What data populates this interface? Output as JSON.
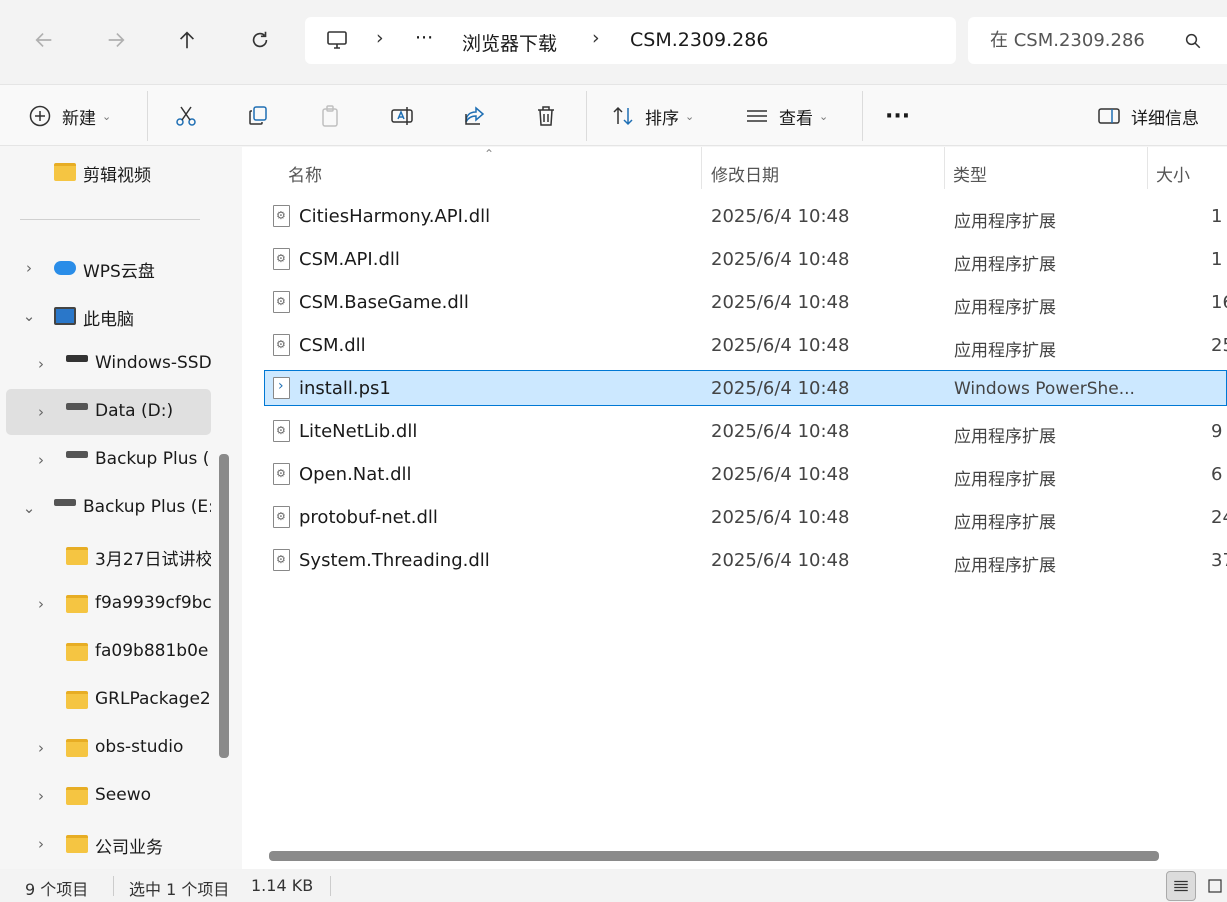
{
  "nav": {
    "breadcrumb": [
      "浏览器下载",
      "CSM.2309.286"
    ],
    "more": "···",
    "search_placeholder": "在 CSM.2309.286"
  },
  "toolbar": {
    "new_label": "新建",
    "sort_label": "排序",
    "view_label": "查看",
    "more": "···",
    "details_label": "详细信息"
  },
  "sidebar": {
    "items": [
      {
        "label": "剪辑视频",
        "icon": "folder-icon",
        "expandable": false
      },
      {
        "label": "WPS云盘",
        "icon": "cloud-icon",
        "expandable": true,
        "expanded": false
      },
      {
        "label": "此电脑",
        "icon": "computer-icon",
        "expandable": true,
        "expanded": true
      },
      {
        "label": "Windows-SSD",
        "icon": "windows-drive-icon",
        "expandable": true,
        "expanded": false
      },
      {
        "label": "Data (D:)",
        "icon": "drive-icon",
        "expandable": true,
        "expanded": false,
        "selected": true
      },
      {
        "label": "Backup Plus (",
        "icon": "drive-icon",
        "expandable": true,
        "expanded": false
      },
      {
        "label": "Backup Plus (E:",
        "icon": "drive-icon",
        "expandable": true,
        "expanded": true
      },
      {
        "label": "3月27日试讲校",
        "icon": "folder-icon",
        "expandable": false
      },
      {
        "label": "f9a9939cf9bc",
        "icon": "folder-icon",
        "expandable": true,
        "expanded": false
      },
      {
        "label": "fa09b881b0e",
        "icon": "folder-icon",
        "expandable": false
      },
      {
        "label": "GRLPackage2",
        "icon": "folder-icon",
        "expandable": false
      },
      {
        "label": "obs-studio",
        "icon": "folder-icon",
        "expandable": true,
        "expanded": false
      },
      {
        "label": "Seewo",
        "icon": "folder-icon",
        "expandable": true,
        "expanded": false
      },
      {
        "label": "公司业务",
        "icon": "folder-icon",
        "expandable": true,
        "expanded": false
      }
    ]
  },
  "columns": {
    "name": "名称",
    "date": "修改日期",
    "type": "类型",
    "size": "大小"
  },
  "files": [
    {
      "name": "CitiesHarmony.API.dll",
      "date": "2025/6/4 10:48",
      "type": "应用程序扩展",
      "size": "1",
      "icon": "dll-file-icon"
    },
    {
      "name": "CSM.API.dll",
      "date": "2025/6/4 10:48",
      "type": "应用程序扩展",
      "size": "1",
      "icon": "dll-file-icon"
    },
    {
      "name": "CSM.BaseGame.dll",
      "date": "2025/6/4 10:48",
      "type": "应用程序扩展",
      "size": "16",
      "icon": "dll-file-icon"
    },
    {
      "name": "CSM.dll",
      "date": "2025/6/4 10:48",
      "type": "应用程序扩展",
      "size": "25",
      "icon": "dll-file-icon"
    },
    {
      "name": "install.ps1",
      "date": "2025/6/4 10:48",
      "type": "Windows PowerShe...",
      "size": "",
      "icon": "powershell-file-icon",
      "selected": true
    },
    {
      "name": "LiteNetLib.dll",
      "date": "2025/6/4 10:48",
      "type": "应用程序扩展",
      "size": "9",
      "icon": "dll-file-icon"
    },
    {
      "name": "Open.Nat.dll",
      "date": "2025/6/4 10:48",
      "type": "应用程序扩展",
      "size": "6",
      "icon": "dll-file-icon"
    },
    {
      "name": "protobuf-net.dll",
      "date": "2025/6/4 10:48",
      "type": "应用程序扩展",
      "size": "24",
      "icon": "dll-file-icon"
    },
    {
      "name": "System.Threading.dll",
      "date": "2025/6/4 10:48",
      "type": "应用程序扩展",
      "size": "37",
      "icon": "dll-file-icon"
    }
  ],
  "status": {
    "count": "9 个项目",
    "selection": "选中 1 个项目",
    "size": "1.14 KB"
  }
}
